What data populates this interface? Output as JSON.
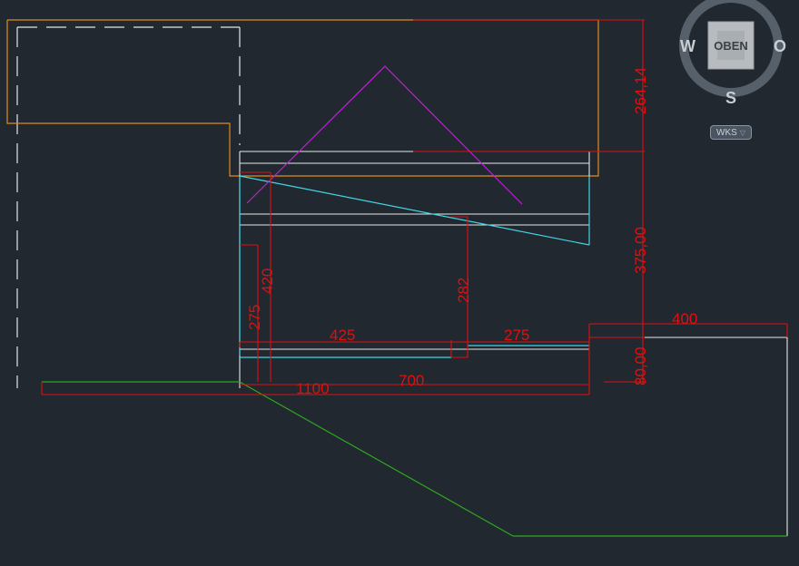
{
  "viewcube": {
    "face_label": "OBEN",
    "west": "W",
    "east": "O",
    "south": "S"
  },
  "ucs_menu": {
    "label": "WKS",
    "icon": "chevron-down-icon"
  },
  "dimensions": {
    "d264": "264,14",
    "d375": "375,00",
    "d420": "420",
    "d275_vertical": "275",
    "d282": "282",
    "d425": "425",
    "d275_horizontal": "275",
    "d400": "400",
    "d80": "80,00",
    "d700": "700",
    "d1100": "1100"
  },
  "colors": {
    "background": "#212830",
    "dimension_red": "#e01010",
    "outline_orange": "#e08a1e",
    "slope_cyan": "#3fd6e6",
    "roof_magenta": "#c21fd6",
    "ground_green": "#2fa81f",
    "line_white": "#e6e6e6"
  }
}
